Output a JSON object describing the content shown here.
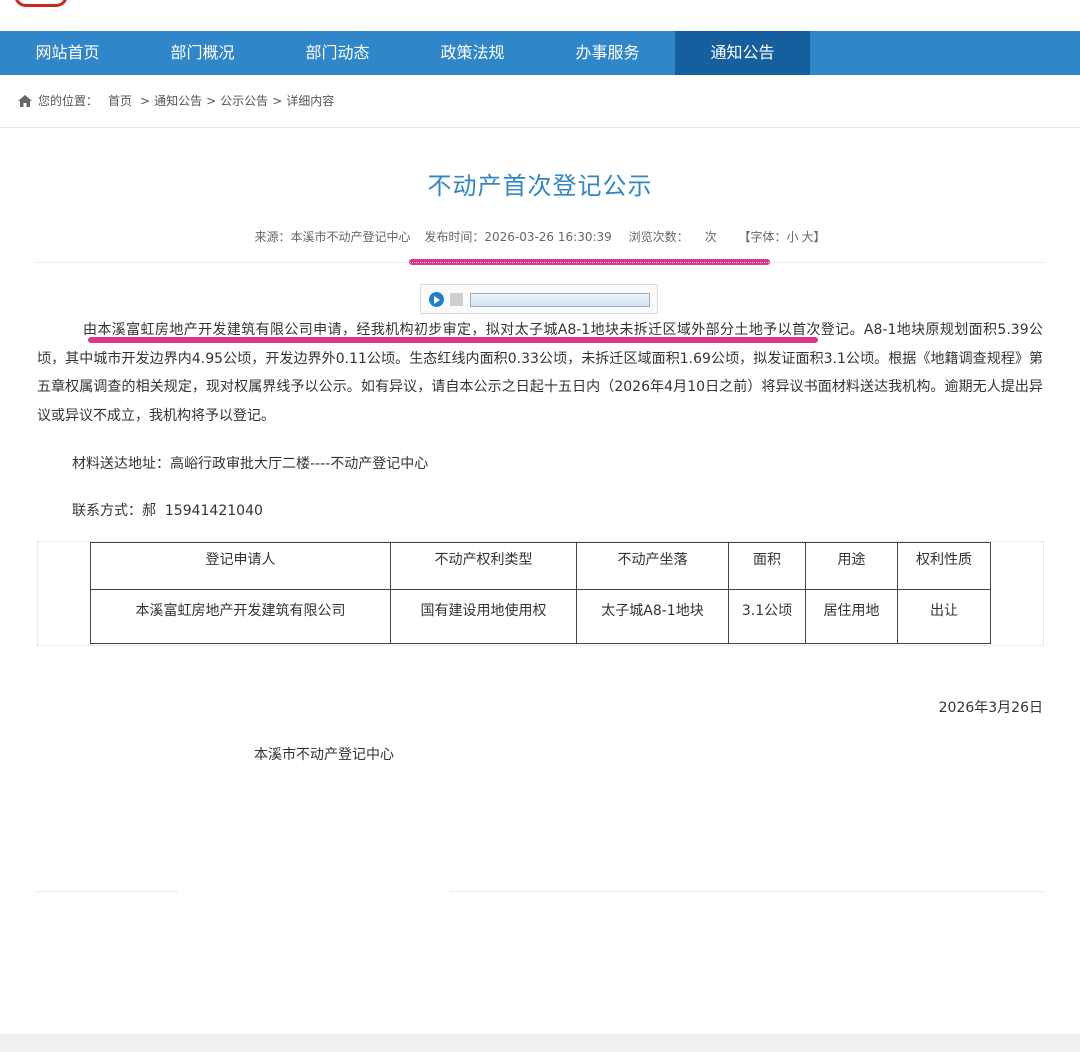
{
  "colors": {
    "nav_bg": "#2f86c8",
    "nav_active_bg": "#165f9f",
    "title": "#2f86c8",
    "highlight": "#e0358f"
  },
  "nav": {
    "items": [
      {
        "label": "网站首页"
      },
      {
        "label": "部门概况"
      },
      {
        "label": "部门动态"
      },
      {
        "label": "政策法规"
      },
      {
        "label": "办事服务"
      },
      {
        "label": "通知公告"
      }
    ],
    "active": "通知公告"
  },
  "breadcrumb": {
    "icon": "home-icon",
    "prefix": "您的位置：",
    "items": [
      "首页",
      "通知公告",
      "公示公告",
      "详细内容"
    ],
    "separator": ">"
  },
  "article": {
    "title": "不动产首次登记公示",
    "meta": {
      "source_label": "来源：",
      "source": "本溪市不动产登记中心",
      "publish_label": "发布时间：",
      "publish_time": "2026-03-26 16:30:39",
      "views_label": "浏览次数：",
      "views_unit": "次",
      "font_open": "【字体：",
      "font_small": "小",
      "font_large": "大",
      "font_close": "】"
    },
    "player": {
      "play_icon": "play-icon",
      "stop_icon": "stop-icon"
    },
    "paragraph": "由本溪富虹房地产开发建筑有限公司申请，经我机构初步审定，拟对太子城A8-1地块未拆迁区域外部分土地予以首次登记。A8-1地块原规划面积5.39公顷，其中城市开发边界内4.95公顷，开发边界外0.11公顷。生态红线内面积0.33公顷，未拆迁区域面积1.69公顷，拟发证面积3.1公顷。根据《地籍调查规程》第五章权属调查的相关规定，现对权属界线予以公示。如有异议，请自本公示之日起十五日内（2026年4月10日之前）将异议书面材料送达我机构。逾期无人提出异议或异议不成立，我机构将予以登记。",
    "address": "材料送达地址：高峪行政审批大厅二楼----不动产登记中心",
    "contact": "联系方式：郝  15941421040",
    "table": {
      "headers": [
        "登记申请人",
        "不动产权利类型",
        "不动产坐落",
        "面积",
        "用途",
        "权利性质"
      ],
      "rows": [
        [
          "本溪富虹房地产开发建筑有限公司",
          "国有建设用地使用权",
          "太子城A8-1地块",
          "3.1公顷",
          "居住用地",
          "出让"
        ]
      ]
    },
    "date": "2026年3月26日",
    "org": "本溪市不动产登记中心"
  }
}
